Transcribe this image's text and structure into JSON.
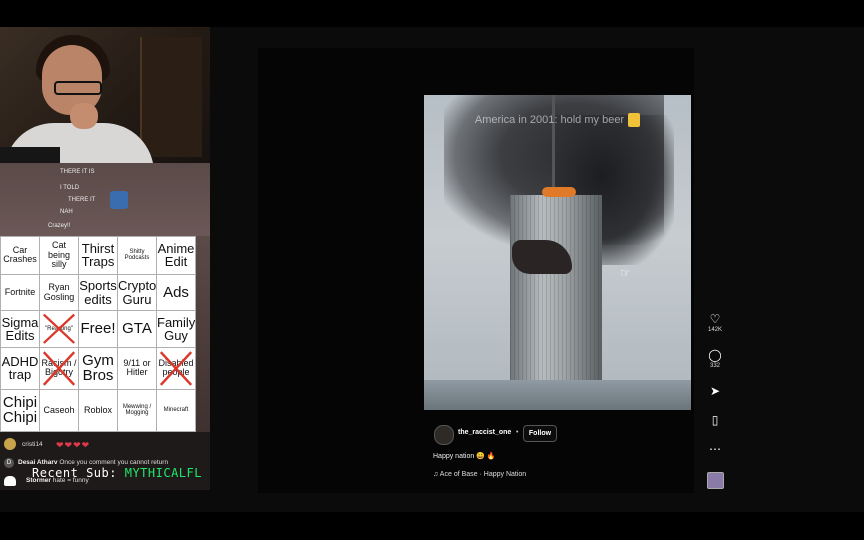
{
  "chat": {
    "lines": [
      {
        "user": "",
        "text": "THERE IT IS"
      },
      {
        "user": "",
        "text": "I TOLD"
      },
      {
        "user": "",
        "text": "THERE IT"
      },
      {
        "user": "",
        "text": "NAH"
      },
      {
        "user": "",
        "text": "Crazey!!"
      }
    ]
  },
  "bingo": {
    "rows": [
      [
        {
          "t": "Car Crashes",
          "s": "fs-m"
        },
        {
          "t": "Cat being silly",
          "s": "fs-m"
        },
        {
          "t": "Thirst Traps",
          "s": "fs-l"
        },
        {
          "t": "Shitty Podcasts",
          "s": "fs-s"
        },
        {
          "t": "Anime Edit",
          "s": "fs-l"
        }
      ],
      [
        {
          "t": "Fortnite",
          "s": "fs-m"
        },
        {
          "t": "Ryan Gosling",
          "s": "fs-m"
        },
        {
          "t": "Sports edits",
          "s": "fs-l"
        },
        {
          "t": "Crypto Guru",
          "s": "fs-l"
        },
        {
          "t": "Ads",
          "s": "fs-xl"
        }
      ],
      [
        {
          "t": "Sigma Edits",
          "s": "fs-l"
        },
        {
          "t": "\"Reacting\"",
          "s": "fs-s",
          "x": true
        },
        {
          "t": "Free!",
          "s": "fs-xl"
        },
        {
          "t": "GTA",
          "s": "fs-xl"
        },
        {
          "t": "Family Guy",
          "s": "fs-l"
        }
      ],
      [
        {
          "t": "ADHD trap",
          "s": "fs-l"
        },
        {
          "t": "Racism / Bigotry",
          "s": "fs-m",
          "x": true
        },
        {
          "t": "Gym Bros",
          "s": "fs-xl"
        },
        {
          "t": "9/11 or Hitler",
          "s": "fs-m"
        },
        {
          "t": "Disabled people",
          "s": "fs-m",
          "x": true
        }
      ],
      [
        {
          "t": "Chipi Chipi",
          "s": "fs-xl"
        },
        {
          "t": "Caseoh",
          "s": "fs-m"
        },
        {
          "t": "Roblox",
          "s": "fs-m"
        },
        {
          "t": "Mewwing / Mogging",
          "s": "fs-s"
        },
        {
          "t": "Minecraft",
          "s": "fs-s"
        }
      ]
    ]
  },
  "bottom_chat": {
    "line1_user": "cristi14",
    "line2_user": "Desai Atharv",
    "line2_text": "Once you comment you cannot return",
    "line3_user": "Stormer",
    "line3_text": "hate = funny",
    "recent_label": "Recent Sub:",
    "recent_name": "MYTHICALFL",
    "avatar_letter": "D"
  },
  "reel": {
    "caption": "America in 2001: hold my beer",
    "username": "the_raccist_one",
    "dot": "•",
    "follow_label": "Follow",
    "description": "Happy nation 😀 🔥",
    "music": "♫ Ace of Base · Happy Nation"
  },
  "actions": {
    "likes": "142K",
    "comments": "332"
  },
  "icons": {
    "like": "heart-icon",
    "comment": "comment-icon",
    "share": "send-icon",
    "save": "bookmark-icon",
    "more": "more-icon",
    "cursor": "hand-cursor-icon"
  }
}
